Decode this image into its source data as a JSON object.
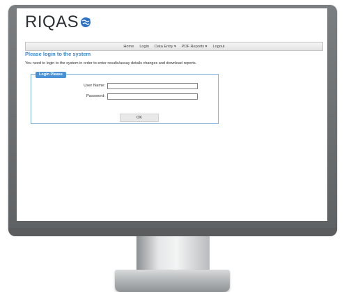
{
  "app": {
    "logo_text": "RIQAS",
    "logo_icon": "globe-icon"
  },
  "nav": {
    "items": [
      "Home",
      "Login",
      "Data Entry ▾",
      "PDF Reports ▾",
      "Logout"
    ]
  },
  "page": {
    "heading": "Please login to the system",
    "intro": "You need to login to the system in order to enter results/assay details changes and download reports."
  },
  "login": {
    "legend": "Login Please",
    "username_label": "User Name:",
    "username_value": "",
    "password_label": "Password:",
    "password_value": "",
    "ok_label": "OK"
  },
  "colors": {
    "accent": "#3b87cf",
    "legend_bg": "#4a92d6",
    "panel_border": "#7fb2df",
    "bezel": "#6b6e70"
  }
}
